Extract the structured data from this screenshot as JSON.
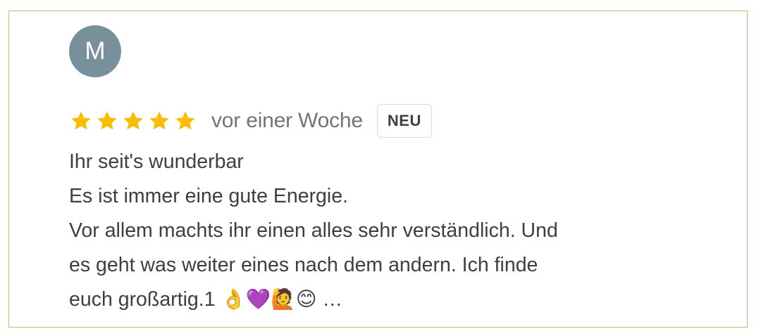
{
  "review": {
    "avatar_initial": "M",
    "rating": 5,
    "star_color": "#fbbc04",
    "time_ago": "vor einer Woche",
    "badge": "NEU",
    "text_lines": [
      "Ihr seit's wunderbar",
      "Es ist immer eine gute Energie.",
      "Vor allem machts ihr einen alles sehr verständlich. Und",
      "es geht was weiter eines nach dem andern. Ich finde",
      "euch großartig.1 👌💜🙋😊 …"
    ]
  }
}
